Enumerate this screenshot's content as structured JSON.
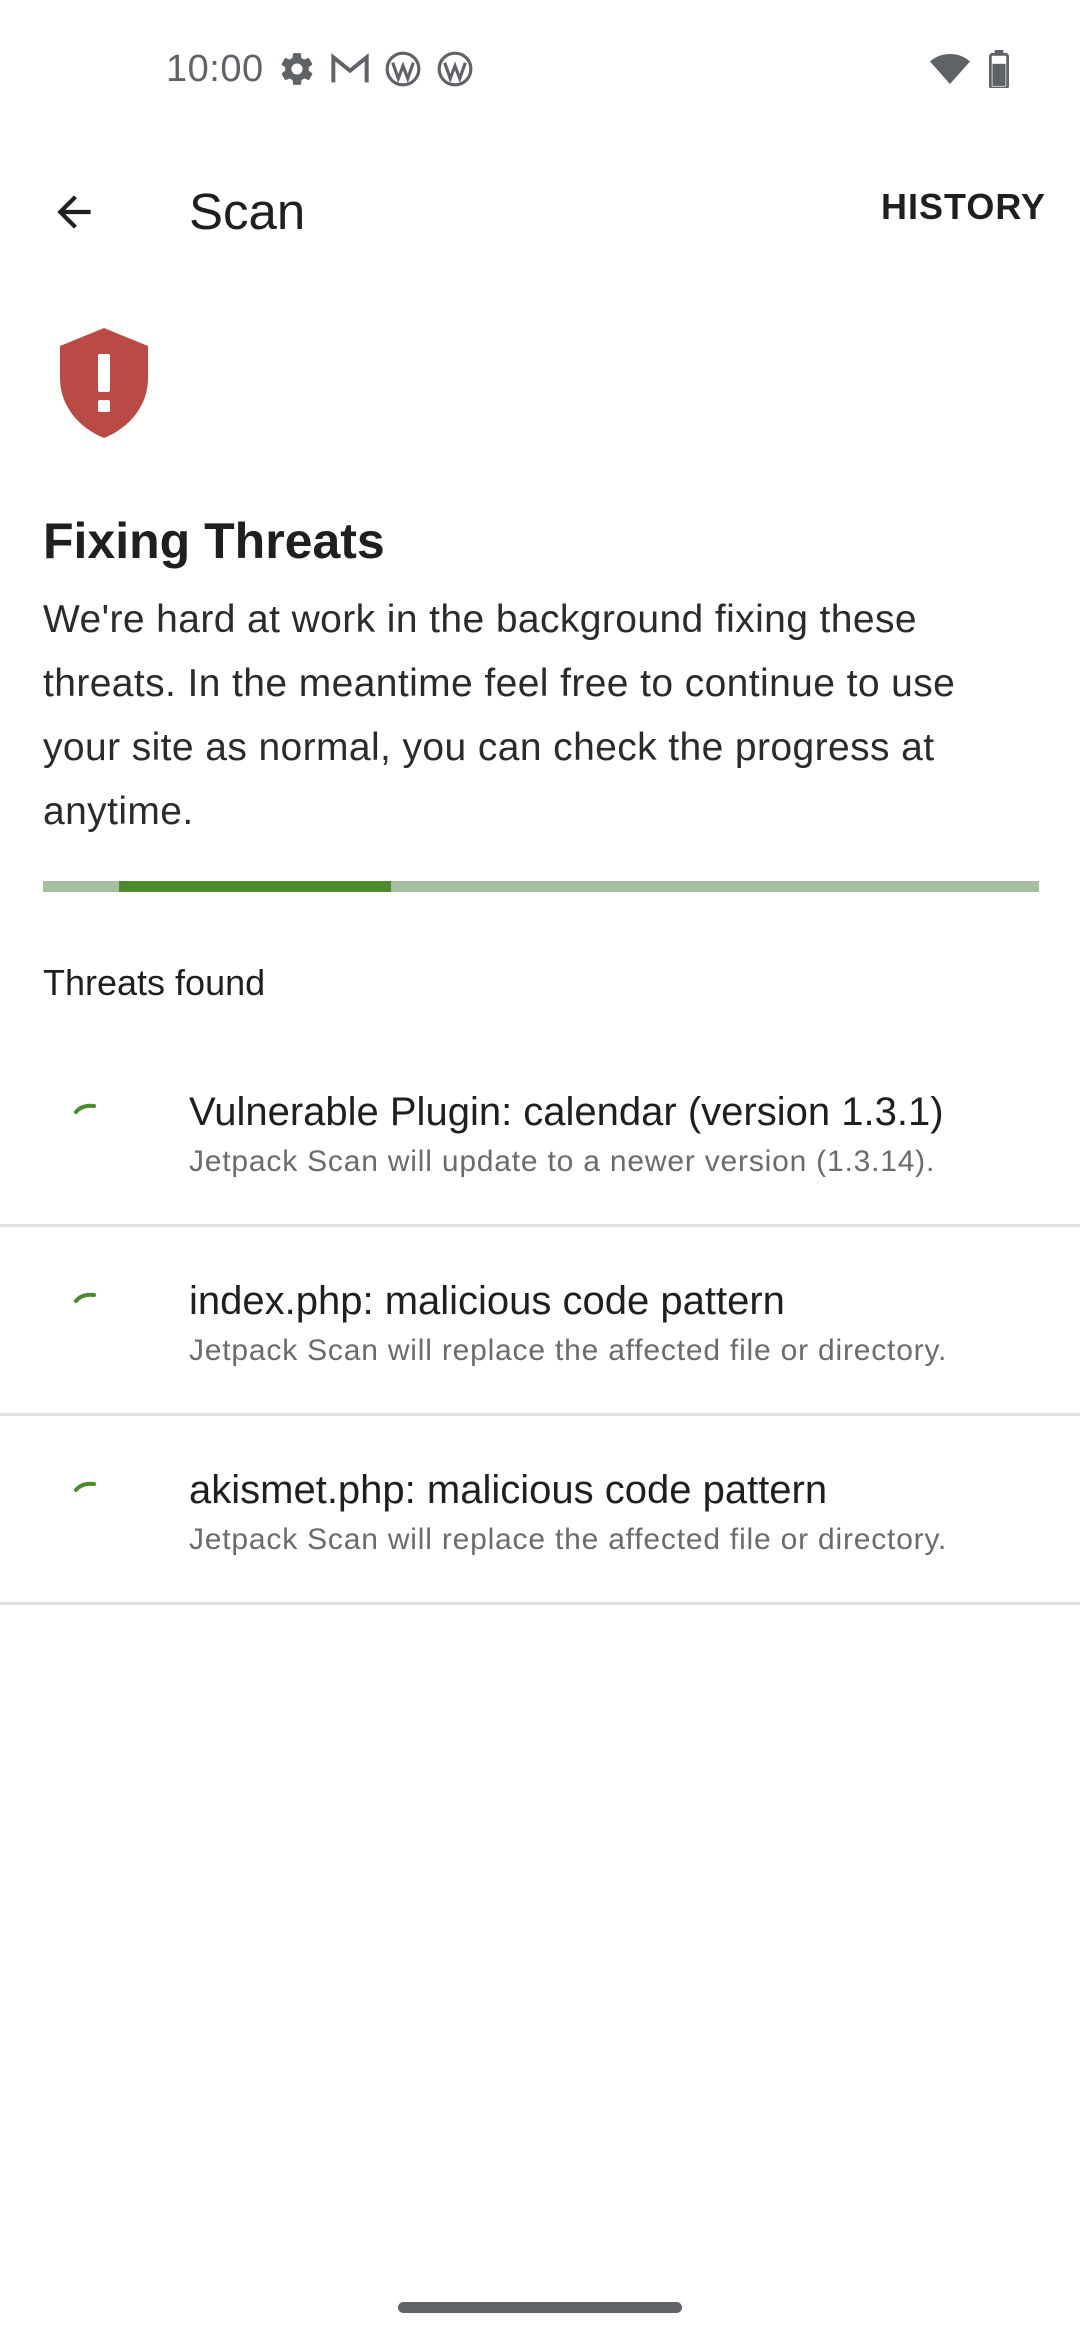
{
  "status_bar": {
    "time": "10:00",
    "left_icons": [
      "settings-icon",
      "gmail-icon",
      "wordpress-icon",
      "wordpress-icon"
    ],
    "right_icons": [
      "wifi-icon",
      "battery-icon"
    ]
  },
  "app_bar": {
    "back_icon": "arrow-back-icon",
    "title": "Scan",
    "history_label": "HISTORY"
  },
  "status": {
    "icon": "shield-alert-icon",
    "icon_color": "#b94a44",
    "heading": "Fixing Threats",
    "description": "We're hard at work in the background fixing these threats. In the meantime feel free to continue to use your site as normal, you can check the progress at anytime."
  },
  "progress": {
    "indeterminate": true,
    "track_color": "#a7bfa1",
    "fill_color": "#4a8b2c"
  },
  "threats": {
    "section_label": "Threats found",
    "items": [
      {
        "title": "Vulnerable Plugin: calendar (version 1.3.1)",
        "subtitle": "Jetpack Scan will update to a newer version (1.3.14)."
      },
      {
        "title": "index.php: malicious code pattern",
        "subtitle": "Jetpack Scan will replace the affected file or directory."
      },
      {
        "title": "akismet.php: malicious code pattern",
        "subtitle": "Jetpack Scan will replace the affected file or directory."
      }
    ]
  },
  "colors": {
    "accent": "#4a8b2c",
    "danger": "#b94a44"
  }
}
